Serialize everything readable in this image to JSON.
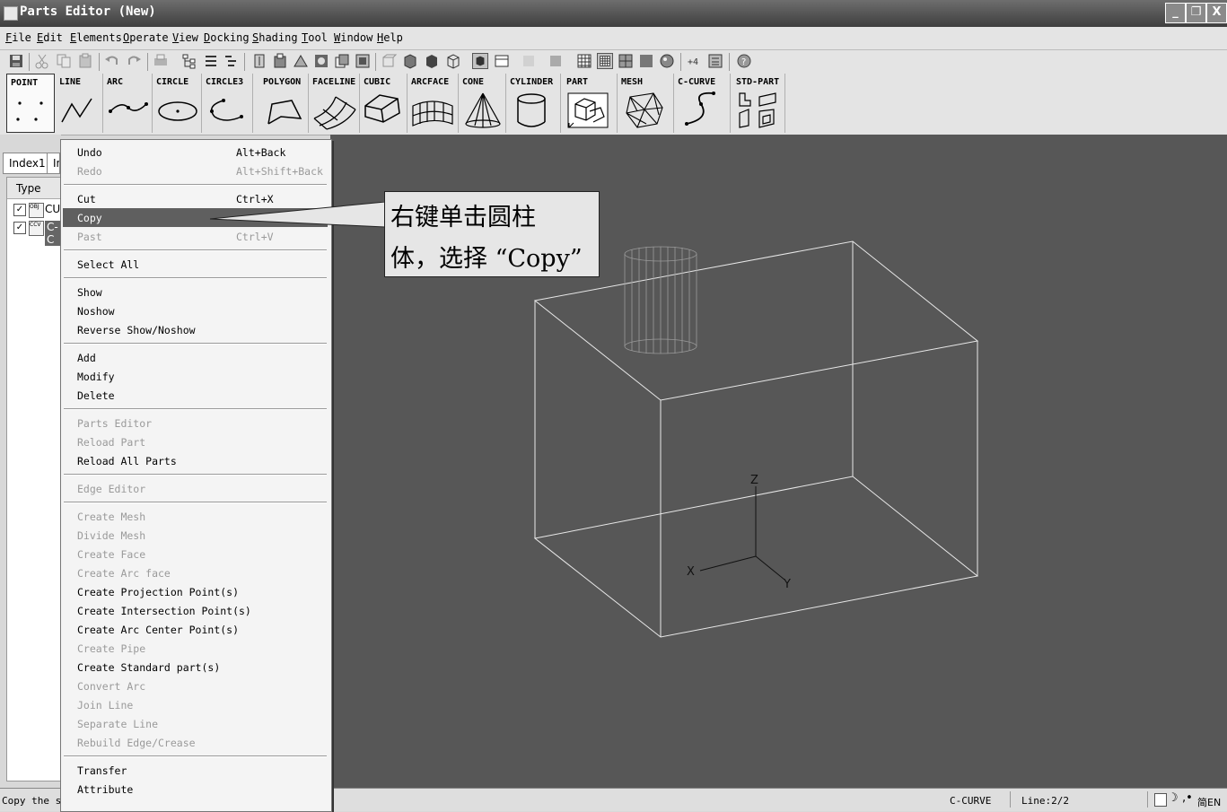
{
  "window": {
    "title": "Parts Editor (New)",
    "controls": [
      "_",
      "❐",
      "X"
    ]
  },
  "menubar": [
    "File",
    "Edit",
    "Elements",
    "Operate",
    "View",
    "Docking",
    "Shading",
    "Tool",
    "Window",
    "Help"
  ],
  "shapes": [
    "POINT",
    "LINE",
    "ARC",
    "CIRCLE",
    "CIRCLE3",
    "POLYGON",
    "FACELINE",
    "CUBIC",
    "ARCFACE",
    "CONE",
    "CYLINDER",
    "PART",
    "MESH",
    "C-CURVE",
    "STD-PART"
  ],
  "left_panel": {
    "tabs": [
      "Index1",
      "In"
    ],
    "list_header": "Type",
    "rows": [
      {
        "icon": "OBJ",
        "label": "CU",
        "checked": true,
        "selected": false
      },
      {
        "icon": "CCV",
        "label": "C-C",
        "checked": true,
        "selected": true
      }
    ]
  },
  "context_menu": {
    "items": [
      {
        "label": "Undo",
        "shortcut": "Alt+Back",
        "enabled": true
      },
      {
        "label": "Redo",
        "shortcut": "Alt+Shift+Back",
        "enabled": false
      },
      {
        "sep": true
      },
      {
        "label": "Cut",
        "shortcut": "Ctrl+X",
        "enabled": true
      },
      {
        "label": "Copy",
        "shortcut": "",
        "enabled": true,
        "highlighted": true
      },
      {
        "label": "Past",
        "shortcut": "Ctrl+V",
        "enabled": false
      },
      {
        "sep": true
      },
      {
        "label": "Select All",
        "shortcut": "",
        "enabled": true
      },
      {
        "sep": true
      },
      {
        "label": "Show",
        "shortcut": "",
        "enabled": true
      },
      {
        "label": "Noshow",
        "shortcut": "",
        "enabled": true
      },
      {
        "label": "Reverse Show/Noshow",
        "shortcut": "",
        "enabled": true
      },
      {
        "sep": true
      },
      {
        "label": "Add",
        "shortcut": "",
        "enabled": true
      },
      {
        "label": "Modify",
        "shortcut": "",
        "enabled": true
      },
      {
        "label": "Delete",
        "shortcut": "",
        "enabled": true
      },
      {
        "sep": true
      },
      {
        "label": "Parts Editor",
        "shortcut": "",
        "enabled": false
      },
      {
        "label": "Reload Part",
        "shortcut": "",
        "enabled": false
      },
      {
        "label": "Reload All Parts",
        "shortcut": "",
        "enabled": true
      },
      {
        "sep": true
      },
      {
        "label": "Edge Editor",
        "shortcut": "",
        "enabled": false
      },
      {
        "sep": true
      },
      {
        "label": "Create Mesh",
        "shortcut": "",
        "enabled": false
      },
      {
        "label": "Divide Mesh",
        "shortcut": "",
        "enabled": false
      },
      {
        "label": "Create Face",
        "shortcut": "",
        "enabled": false
      },
      {
        "label": "Create Arc face",
        "shortcut": "",
        "enabled": false
      },
      {
        "label": "Create Projection Point(s)",
        "shortcut": "",
        "enabled": true
      },
      {
        "label": "Create Intersection Point(s)",
        "shortcut": "",
        "enabled": true
      },
      {
        "label": "Create Arc Center Point(s)",
        "shortcut": "",
        "enabled": true
      },
      {
        "label": "Create Pipe",
        "shortcut": "",
        "enabled": false
      },
      {
        "label": "Create Standard part(s)",
        "shortcut": "",
        "enabled": true
      },
      {
        "label": "Convert Arc",
        "shortcut": "",
        "enabled": false
      },
      {
        "label": "Join Line",
        "shortcut": "",
        "enabled": false
      },
      {
        "label": "Separate Line",
        "shortcut": "",
        "enabled": false
      },
      {
        "label": "Rebuild Edge/Crease",
        "shortcut": "",
        "enabled": false
      },
      {
        "sep": true
      },
      {
        "label": "Transfer",
        "shortcut": "",
        "enabled": true
      },
      {
        "label": "Attribute",
        "shortcut": "",
        "enabled": true
      }
    ]
  },
  "callout": {
    "line1": "右键单击圆柱",
    "line2": "体，选择 “Copy”"
  },
  "viewport": {
    "axes": {
      "z": "Z",
      "x": "X",
      "y": "Y"
    },
    "background": "#575757"
  },
  "status": {
    "left": "Copy the se",
    "mode": "C-CURVE",
    "line": "Line:2/2",
    "ime": "简EN"
  }
}
